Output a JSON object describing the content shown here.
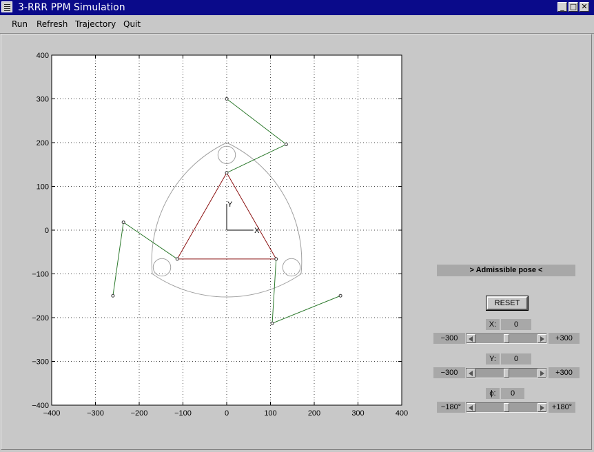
{
  "window": {
    "title": "3-RRR PPM Simulation",
    "buttons": [
      "_",
      "□",
      "✕"
    ]
  },
  "menu": [
    "Run",
    "Refresh",
    "Trajectory",
    "Quit"
  ],
  "chart_data": {
    "type": "line",
    "xlim": [
      -400,
      400
    ],
    "ylim": [
      -400,
      400
    ],
    "xticks": [
      -400,
      -300,
      -200,
      -100,
      0,
      100,
      200,
      300,
      400
    ],
    "yticks": [
      -400,
      -300,
      -200,
      -100,
      0,
      100,
      200,
      300,
      400
    ],
    "xtick_labels": [
      "−400",
      "−300",
      "−200",
      "−100",
      "0",
      "100",
      "200",
      "300",
      "400"
    ],
    "ytick_labels": [
      "−400",
      "−300",
      "−200",
      "−100",
      "0",
      "100",
      "200",
      "300",
      "400"
    ],
    "grid": true,
    "frame_axes": {
      "x_label": "X",
      "y_label": "Y",
      "length": 60
    },
    "base_points": [
      [
        0,
        300
      ],
      [
        260,
        -150
      ],
      [
        -260,
        -150
      ]
    ],
    "elbows": [
      [
        136,
        196
      ],
      [
        104,
        -213
      ],
      [
        -236,
        18
      ]
    ],
    "platform": [
      [
        0,
        131
      ],
      [
        113,
        -66
      ],
      [
        -113,
        -66
      ]
    ],
    "workspace_circles": [
      {
        "c": [
          0,
          172
        ],
        "r": 20
      },
      {
        "c": [
          148,
          -85
        ],
        "r": 20
      },
      {
        "c": [
          -148,
          -85
        ],
        "r": 20
      }
    ],
    "workspace_arcs": [
      {
        "from": [
          -170,
          -100
        ],
        "to": [
          0,
          200
        ],
        "r": 300
      },
      {
        "from": [
          0,
          200
        ],
        "to": [
          170,
          -100
        ],
        "r": 300
      },
      {
        "from": [
          170,
          -100
        ],
        "to": [
          -170,
          -100
        ],
        "r": 300
      }
    ],
    "colors": {
      "links": "#2d7a2d",
      "platform": "#8b1010",
      "workspace": "#a0a0a0",
      "grid": "#444444"
    }
  },
  "controls": {
    "status": "> Admissible pose <",
    "reset": "RESET",
    "x": {
      "label": "X:",
      "value": "0",
      "min": "−300",
      "max": "+300",
      "position": 0.5
    },
    "y": {
      "label": "Y:",
      "value": "0",
      "min": "−300",
      "max": "+300",
      "position": 0.5
    },
    "phi": {
      "label": "ϕ:",
      "value": "0",
      "min": "−180°",
      "max": "+180°",
      "position": 0.5
    }
  }
}
